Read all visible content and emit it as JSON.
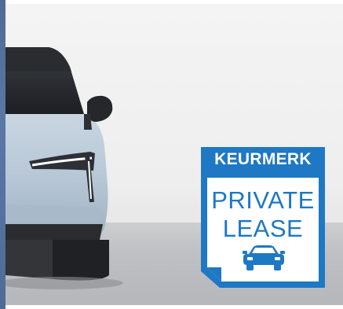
{
  "image": {
    "left_bar_color": "#5a77a6",
    "background_color": "#eeeeee",
    "floor_color": "#bdbfc2",
    "car_color": "#b9c9d7",
    "headlight_color": "#ffffff"
  },
  "badge": {
    "title": "KEURMERK",
    "line1": "PRIVATE",
    "line2": "LEASE",
    "icon": "car-icon",
    "accent_color": "#1e78c4",
    "background_color": "#ffffff"
  }
}
